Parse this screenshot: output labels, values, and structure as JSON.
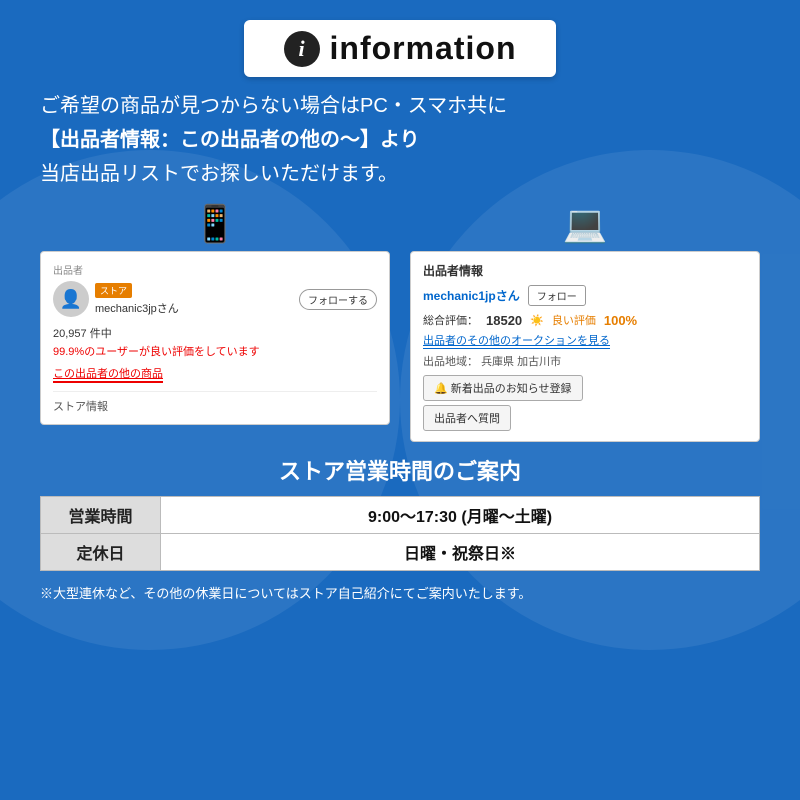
{
  "header": {
    "title": "information",
    "icon_label": "i"
  },
  "main_text": {
    "line1": "ご希望の商品が見つからない場合はPC・スマホ共に",
    "line2": "【出品者情報：この出品者の他の〜】より",
    "line3": "当店出品リストでお探しいただけます。"
  },
  "mobile_screenshot": {
    "section_label": "出品者",
    "store_badge": "ストア",
    "username": "mechanic3jpさん",
    "follow_btn": "フォローする",
    "stats": "20,957 件中",
    "positive_text": "99.9%のユーザーが良い評価をしています",
    "link_text": "この出品者の他の商品",
    "store_info": "ストア情報"
  },
  "desktop_screenshot": {
    "section_label": "出品者情報",
    "username": "mechanic1jpさん",
    "follow_btn": "フォロー",
    "rating_label": "総合評価：",
    "rating_num": "18520",
    "good_label": "良い評価",
    "good_pct": "100%",
    "auction_link": "出品者のその他のオークションを見る",
    "location_label": "出品地域：",
    "location": "兵庫県 加古川市",
    "btn_notify": "🔔 新着出品のお知らせ登録",
    "btn_question": "出品者へ質問"
  },
  "hours_section": {
    "title": "ストア営業時間のご案内",
    "rows": [
      {
        "label": "営業時間",
        "value": "9:00〜17:30 (月曜〜土曜)"
      },
      {
        "label": "定休日",
        "value": "日曜・祝祭日※"
      }
    ]
  },
  "footer_note": "※大型連休など、その他の休業日についてはストア自己紹介にてご案内いたします。",
  "colors": {
    "bg": "#1a6abf",
    "accent_red": "#e00000",
    "accent_blue": "#0066cc"
  }
}
